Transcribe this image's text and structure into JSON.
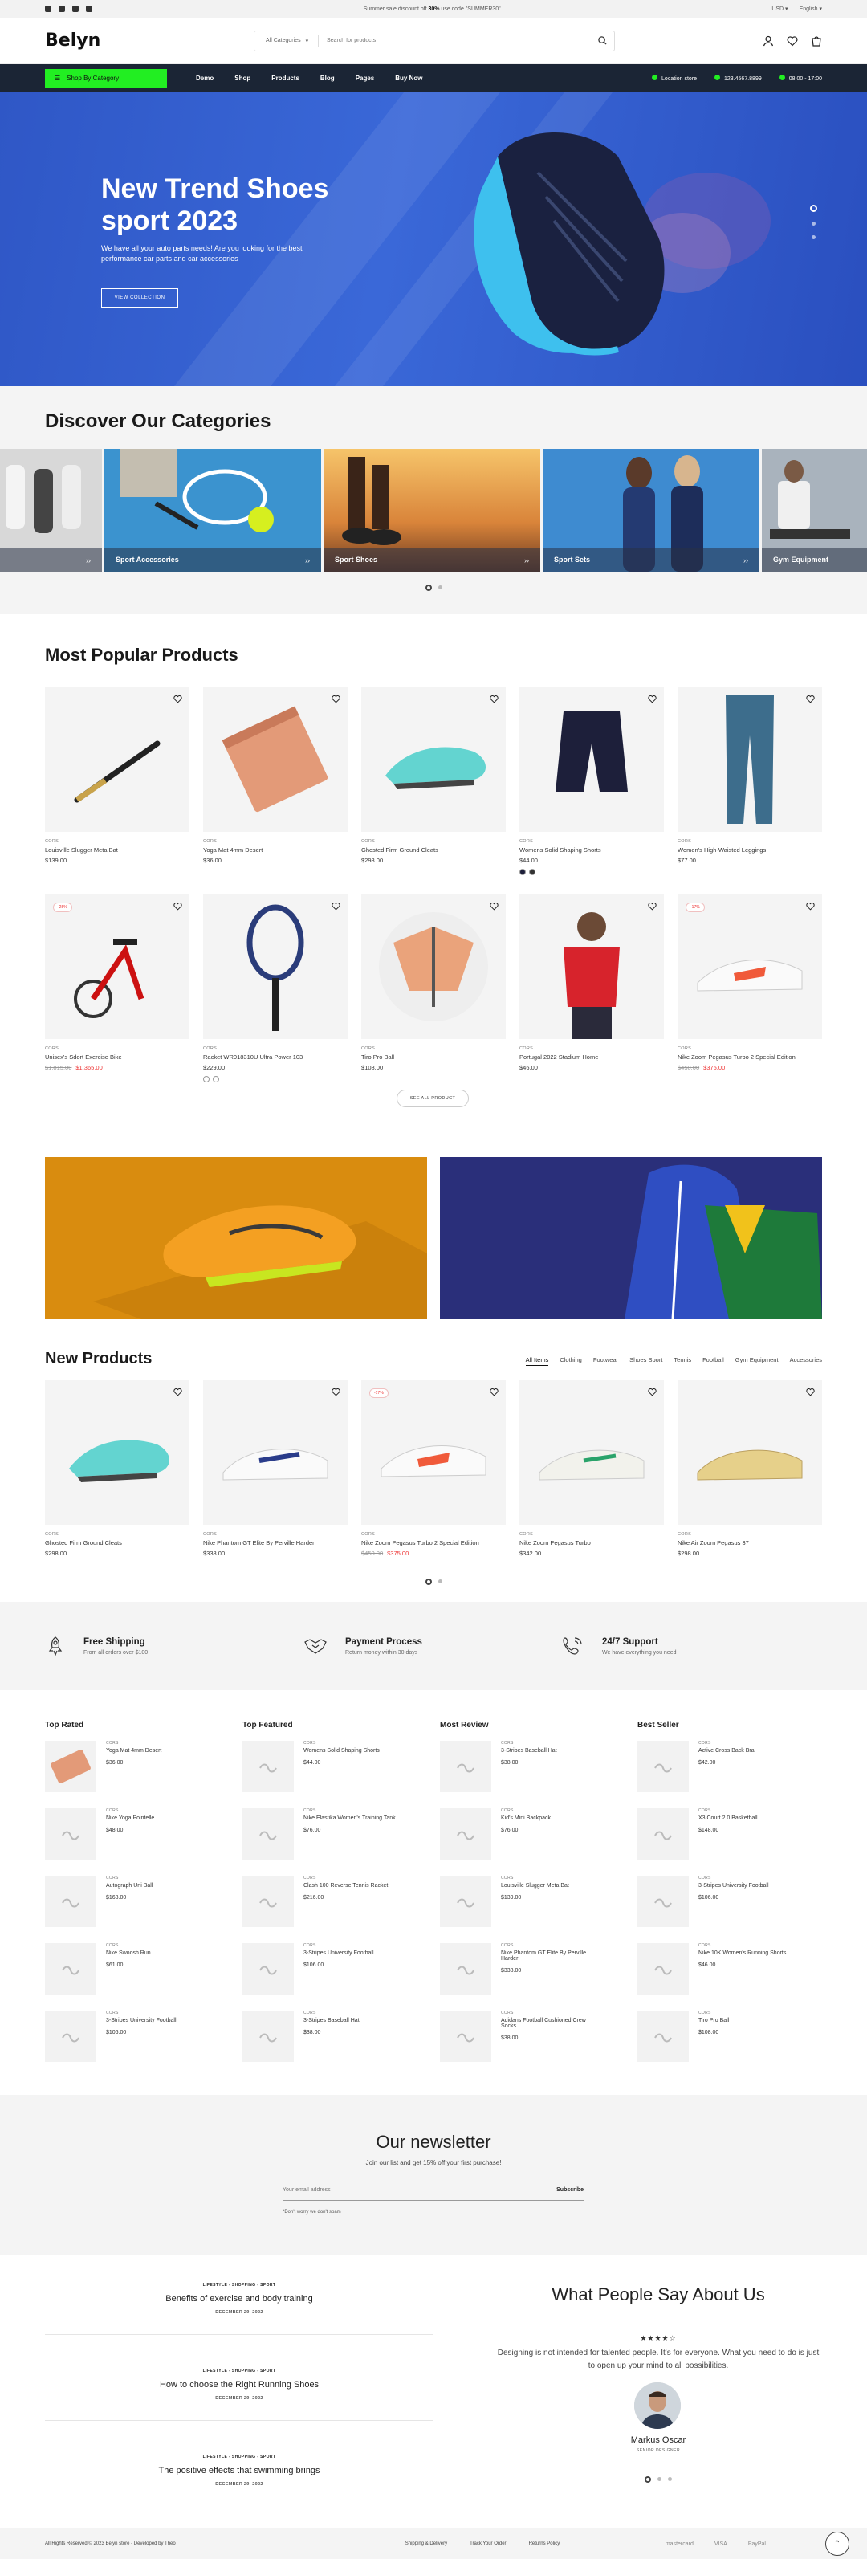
{
  "topbar": {
    "promo_pre": "Summer sale discount off ",
    "promo_pct": "30%",
    "promo_mid": " use code \"SUMMER30\"",
    "currency": "USD",
    "language": "English"
  },
  "header": {
    "logo": "Belyn",
    "category": "All Categories",
    "search_placeholder": "Search for products",
    "wishlist_count": "0",
    "cart_count": "0"
  },
  "nav": {
    "category_button": "Shop By Category",
    "links": [
      "Demo",
      "Shop",
      "Products",
      "Blog",
      "Pages",
      "Buy Now"
    ],
    "location": "Location store",
    "phone": "123.4567.8899",
    "hours": "08:00 - 17:00"
  },
  "hero": {
    "title": "New Trend Shoes sport 2023",
    "subtitle": "We have all your auto parts needs! Are you looking for the best performance car parts and car accessories",
    "cta": "VIEW COLLECTION"
  },
  "categories": {
    "title": "Discover Our Categories",
    "items": [
      "",
      "Sport Accessories",
      "Sport Shoes",
      "Sport Sets",
      "Gym Equipment"
    ]
  },
  "popular": {
    "title": "Most Popular Products",
    "see_all": "SEE ALL PRODUCT",
    "products": [
      {
        "brand": "CORS",
        "name": "Louisville Slugger Meta Bat",
        "price": "$139.00",
        "old": "",
        "badge": ""
      },
      {
        "brand": "CORS",
        "name": "Yoga Mat 4mm Desert",
        "price": "$36.00",
        "old": "",
        "badge": ""
      },
      {
        "brand": "CORS",
        "name": "Ghosted Firm Ground Cleats",
        "price": "$298.00",
        "old": "",
        "badge": ""
      },
      {
        "brand": "CORS",
        "name": "Womens Solid Shaping Shorts",
        "price": "$44.00",
        "old": "",
        "badge": ""
      },
      {
        "brand": "CORS",
        "name": "Women's High-Waisted Leggings",
        "price": "$77.00",
        "old": "",
        "badge": ""
      },
      {
        "brand": "CORS",
        "name": "Unisex's Sdort Exercise Bike",
        "price": "$1,365.00",
        "old": "$1,815.00",
        "badge": "-25%"
      },
      {
        "brand": "CORS",
        "name": "Racket WR018310U Ultra Power 103",
        "price": "$229.00",
        "old": "",
        "badge": ""
      },
      {
        "brand": "CORS",
        "name": "Tiro Pro Ball",
        "price": "$108.00",
        "old": "",
        "badge": ""
      },
      {
        "brand": "CORS",
        "name": "Portugal 2022 Stadium Home",
        "price": "$46.00",
        "old": "",
        "badge": ""
      },
      {
        "brand": "CORS",
        "name": "Nike Zoom Pegasus Turbo 2 Special Edition",
        "price": "$375.00",
        "old": "$450.00",
        "badge": "-17%"
      }
    ]
  },
  "newproducts": {
    "title": "New Products",
    "tabs": [
      "All Items",
      "Clothing",
      "Footwear",
      "Shoes Sport",
      "Tennis",
      "Football",
      "Gym Equipment",
      "Accessories"
    ],
    "products": [
      {
        "brand": "CORS",
        "name": "Ghosted Firm Ground Cleats",
        "price": "$298.00",
        "old": "",
        "badge": ""
      },
      {
        "brand": "CORS",
        "name": "Nike Phantom GT Elite By Perville Harder",
        "price": "$338.00",
        "old": "",
        "badge": ""
      },
      {
        "brand": "CORS",
        "name": "Nike Zoom Pegasus Turbo 2 Special Edition",
        "price": "$375.00",
        "old": "$450.00",
        "badge": "-17%"
      },
      {
        "brand": "CORS",
        "name": "Nike Zoom Pegasus Turbo",
        "price": "$342.00",
        "old": "",
        "badge": ""
      },
      {
        "brand": "CORS",
        "name": "Nike Air Zoom Pegasus 37",
        "price": "$298.00",
        "old": "",
        "badge": ""
      }
    ]
  },
  "features": [
    {
      "title": "Free Shipping",
      "sub": "From all orders over $100"
    },
    {
      "title": "Payment Process",
      "sub": "Return money within 30 days"
    },
    {
      "title": "24/7 Support",
      "sub": "We have everything you need"
    }
  ],
  "lists": [
    {
      "title": "Top Rated",
      "items": [
        [
          "CORS",
          "Yoga Mat 4mm Desert",
          "$36.00"
        ],
        [
          "CORS",
          "Nike Yoga Pointelle",
          "$48.00"
        ],
        [
          "CORS",
          "Autograph Uni Ball",
          "$168.00"
        ],
        [
          "CORS",
          "Nike Swoosh Run",
          "$61.00"
        ],
        [
          "CORS",
          "3-Stripes University Football",
          "$106.00"
        ]
      ]
    },
    {
      "title": "Top Featured",
      "items": [
        [
          "CORS",
          "Womens Solid Shaping Shorts",
          "$44.00"
        ],
        [
          "CORS",
          "Nike Elastika Women's Training Tank",
          "$76.00"
        ],
        [
          "CORS",
          "Clash 100 Reverse Tennis Racket",
          "$216.00"
        ],
        [
          "CORS",
          "3-Stripes University Football",
          "$106.00"
        ],
        [
          "CORS",
          "3-Stripes Baseball Hat",
          "$38.00"
        ]
      ]
    },
    {
      "title": "Most Review",
      "items": [
        [
          "CORS",
          "3-Stripes Baseball Hat",
          "$38.00"
        ],
        [
          "CORS",
          "Kid's Mini Backpack",
          "$76.00"
        ],
        [
          "CORS",
          "Louisville Slugger Meta Bat",
          "$139.00"
        ],
        [
          "CORS",
          "Nike Phantom GT Elite By Perville Harder",
          "$338.00"
        ],
        [
          "CORS",
          "Adidans Football Cushioned Crew Socks",
          "$38.00"
        ]
      ]
    },
    {
      "title": "Best Seller",
      "items": [
        [
          "CORS",
          "Active Cross Back Bra",
          "$42.00"
        ],
        [
          "CORS",
          "X3 Court 2.0 Basketball",
          "$148.00"
        ],
        [
          "CORS",
          "3-Stripes University Football",
          "$106.00"
        ],
        [
          "CORS",
          "Nike 10K Women's Running Shorts",
          "$46.00"
        ],
        [
          "CORS",
          "Tiro Pro Ball",
          "$108.00"
        ]
      ]
    }
  ],
  "newsletter": {
    "title": "Our newsletter",
    "sub": "Join our list and get 15% off your first purchase!",
    "placeholder": "Your email address",
    "button": "Subscribe",
    "note": "*Don't worry we don't spam"
  },
  "blog": [
    {
      "tag": "LIFESTYLE - SHOPPING - SPORT",
      "title": "Benefits of exercise and body training",
      "date": "DECEMBER 29, 2022"
    },
    {
      "tag": "LIFESTYLE - SHOPPING - SPORT",
      "title": "How to choose the Right Running Shoes",
      "date": "DECEMBER 29, 2022"
    },
    {
      "tag": "LIFESTYLE - SHOPPING - SPORT",
      "title": "The positive effects that swimming brings",
      "date": "DECEMBER 29, 2022"
    }
  ],
  "testimonial": {
    "title": "What People Say About Us",
    "stars": "★★★★☆",
    "quote": "Designing is not intended for talented people. It's for everyone. What you need to do is just to open up your mind to all possibilities.",
    "name": "Markus Oscar",
    "role": "SENIOR DESIGNER"
  },
  "footer": {
    "copyright": "All Rights Reserved © 2023 Belyn store - Developed by Theo",
    "links": [
      "Shipping & Delivery",
      "Track Your Order",
      "Returns Policy"
    ],
    "payments": [
      "mastercard",
      "VISA",
      "PayPal"
    ]
  },
  "colors": {
    "navy": "#1b2535",
    "accent": "#22ee22",
    "hero": "#3461d1",
    "sale": "#e33333"
  }
}
